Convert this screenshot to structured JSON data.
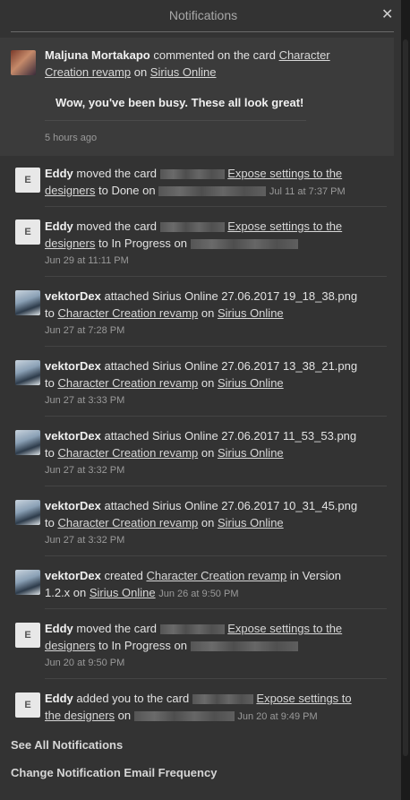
{
  "header": {
    "title": "Notifications",
    "close_label": "✕"
  },
  "first": {
    "actor": "Maljuna Mortakapo",
    "verb": " commented on the card ",
    "card": "Character Creation revamp",
    "on": " on ",
    "board": "Sirius Online",
    "comment": "Wow, you've been busy. These all look great!",
    "time": "5 hours ago"
  },
  "items": [
    {
      "actor": "Eddy",
      "a": " moved the card ",
      "card": "Expose settings to the designers",
      "b": " to Done on ",
      "time": "Jul 11 at 7:37 PM"
    },
    {
      "actor": "Eddy",
      "a": " moved the card ",
      "card": "Expose settings to the designers",
      "b": " to In Progress on ",
      "time": "Jun 29 at 11:11 PM"
    },
    {
      "actor": "vektorDex",
      "a": " attached Sirius Online 27.06.2017 19_18_38.png to ",
      "card": "Character Creation revamp",
      "b": " on ",
      "board": "Sirius Online",
      "time": "Jun 27 at 7:28 PM"
    },
    {
      "actor": "vektorDex",
      "a": " attached Sirius Online 27.06.2017 13_38_21.png to ",
      "card": "Character Creation revamp",
      "b": " on ",
      "board": "Sirius Online",
      "time": "Jun 27 at 3:33 PM"
    },
    {
      "actor": "vektorDex",
      "a": " attached Sirius Online 27.06.2017 11_53_53.png to ",
      "card": "Character Creation revamp",
      "b": " on ",
      "board": "Sirius Online",
      "time": "Jun 27 at 3:32 PM"
    },
    {
      "actor": "vektorDex",
      "a": " attached Sirius Online 27.06.2017 10_31_45.png to ",
      "card": "Character Creation revamp",
      "b": " on ",
      "board": "Sirius Online",
      "time": "Jun 27 at 3:32 PM"
    },
    {
      "actor": "vektorDex",
      "a": " created ",
      "card": "Character Creation revamp",
      "b": " in Version 1.2.x on ",
      "board": "Sirius Online",
      "time": "Jun 26 at 9:50 PM"
    },
    {
      "actor": "Eddy",
      "a": " moved the card ",
      "card": "Expose settings to the designers",
      "b": " to In Progress on ",
      "time": "Jun 20 at 9:50 PM"
    },
    {
      "actor": "Eddy",
      "a": " added you to the card ",
      "card": "Expose settings to the designers",
      "b": " on ",
      "time": "Jun 20 at 9:49 PM"
    }
  ],
  "avatars": {
    "eddy_initial": "E"
  },
  "footer": {
    "see_all": "See All Notifications",
    "frequency": "Change Notification Email Frequency"
  }
}
